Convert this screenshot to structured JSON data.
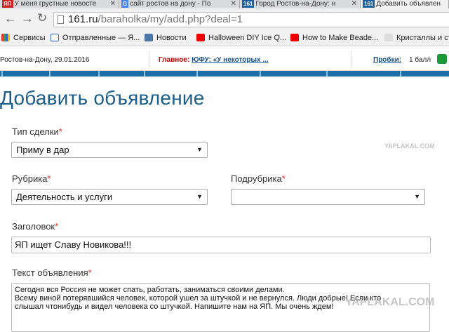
{
  "browser": {
    "tabs": [
      {
        "fav": "ЯП",
        "title": "У меня грустные новосте",
        "active": false
      },
      {
        "fav": "G",
        "title": "сайт ростов на дону - По",
        "active": false
      },
      {
        "fav": "161",
        "title": "Город Ростов-на-Дону: н",
        "active": false
      },
      {
        "fav": "161",
        "title": "Добавить объявлен",
        "active": true
      }
    ],
    "url_host": "161.ru",
    "url_path": "/baraholka/my/add.php?deal=1",
    "bookmarks": [
      {
        "label": "Сервисы",
        "icon": "apps-icon"
      },
      {
        "label": "Отправленные — Я...",
        "icon": "mail-icon"
      },
      {
        "label": "Новости",
        "icon": "vk-icon"
      },
      {
        "label": "Halloween DIY Ice Q...",
        "icon": "youtube-icon"
      },
      {
        "label": "How to Make Beade...",
        "icon": "youtube-icon"
      },
      {
        "label": "Кристаллы и ст",
        "icon": "sv-icon"
      }
    ]
  },
  "site": {
    "date": "Ростов-на-Дону, 29.01.2016",
    "main_label": "Главное:",
    "main_link": "ЮФУ: «У некоторых ...",
    "jams_label": "Пробки:",
    "jams_value": "1 балл"
  },
  "form": {
    "title": "Добавить объявление",
    "deal_type_label": "Тип сделки",
    "deal_type_value": "Приму в дар",
    "rubric_label": "Рубрика",
    "rubric_value": "Деятельность и услуги",
    "subrubric_label": "Подрубрика",
    "subrubric_value": "",
    "heading_label": "Заголовок",
    "heading_value": "ЯП ищет Славу Новикова!!!",
    "text_label": "Текст объявления",
    "text_lines": [
      "Сегодня вся Россия не может спать, работать, заниматься своими делами.",
      "Всему виной потерявшийся человек, которой ушел за штучкой и не вернулся. Люди добрые! Если кто",
      "слышал чтонибудь и видел человека со штучкой. Напишите нам на ЯП. Мы очень ждем!"
    ],
    "required_mark": "*"
  },
  "watermark": {
    "small": "YAPLAKAL.COM",
    "large": "YAPLAKAL.COM"
  },
  "colors": {
    "title_blue": "#1b5e8c",
    "nav_blue": "#1e6fa8",
    "required_red": "#dd3333"
  }
}
